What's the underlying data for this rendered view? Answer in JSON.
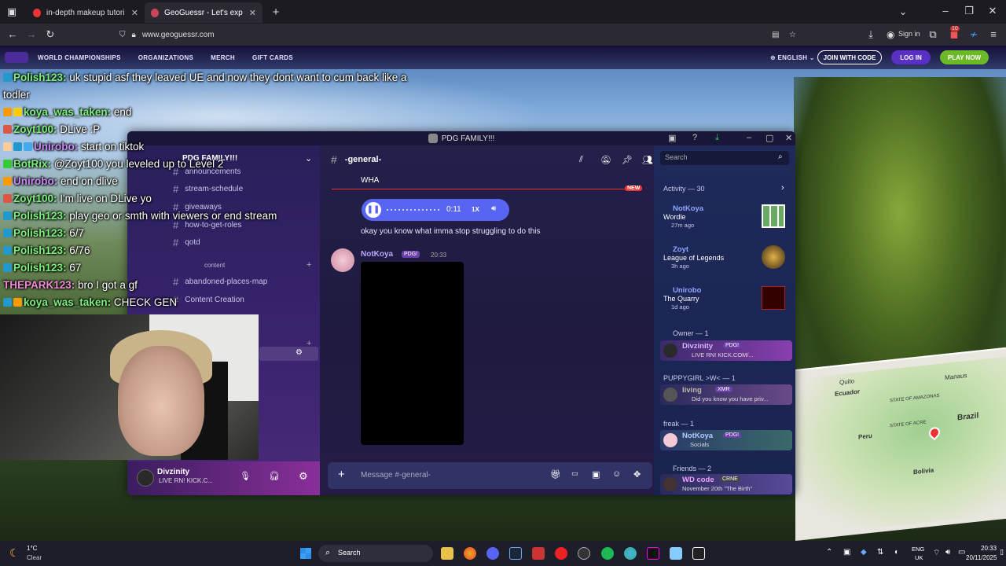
{
  "browser": {
    "tabs": [
      {
        "label": "in-depth makeup tutorial ��",
        "close": "✕"
      },
      {
        "label": "GeoGuessr - Let's explore the w",
        "close": "✕"
      }
    ],
    "new_tab": "+",
    "url": "www.geoguessr.com",
    "sign_in": "Sign in",
    "badge": "10"
  },
  "geoguessr": {
    "nav": [
      "WORLD CHAMPIONSHIPS",
      "ORGANIZATIONS",
      "MERCH",
      "GIFT CARDS"
    ],
    "language": "ENGLISH",
    "join": "JOIN WITH CODE",
    "login": "LOG IN",
    "play": "PLAY NOW"
  },
  "chat": [
    {
      "user": "Polish123:",
      "text": " uk stupid asf they leaved UE and now they dont want to cum back like a todler"
    },
    {
      "user": "koya_was_taken:",
      "text": " end"
    },
    {
      "user": "Zoyt100:",
      "text": " DLive :P"
    },
    {
      "user": "Unirobo:",
      "text": " start on tiktok"
    },
    {
      "user": "BotRix:",
      "text": " @Zoyt100 you leveled up to Level 2"
    },
    {
      "user": "Unirobo:",
      "text": " end on dlive"
    },
    {
      "user": "Zoyt100:",
      "text": " I'm live on DLive yo"
    },
    {
      "user": "Polish123:",
      "text": " play geo or smth with viewers or end stream"
    },
    {
      "user": "Polish123:",
      "text": " 6/7"
    },
    {
      "user": "Polish123:",
      "text": " 6/76"
    },
    {
      "user": "Polish123:",
      "text": " 67"
    },
    {
      "user": "THEPARK123:",
      "text": " bro I got a gf"
    },
    {
      "user": "koya_was_taken:",
      "text": " CHECK GEN"
    }
  ],
  "discord": {
    "window_title": "PDG FAMILY!!!",
    "server_name": "PDG FAMILY!!!",
    "channels": [
      {
        "name": "announcements"
      },
      {
        "name": "stream-schedule"
      },
      {
        "name": "giveaways"
      },
      {
        "name": "how-to-get-roles"
      },
      {
        "name": "qotd"
      },
      {
        "name": "content"
      },
      {
        "name": "abandoned-places-map"
      },
      {
        "name": "Content Creation"
      }
    ],
    "user": {
      "name": "Divzinity",
      "status": "LIVE RN! KICK.C..."
    },
    "channel_header": "-general-",
    "search_placeholder": "Search",
    "messages": {
      "wha": "WHA",
      "new": "NEW",
      "voice_time": "0:11",
      "voice_speed": "1X",
      "text1": "okay you know what imma stop struggling to do this",
      "author": "NotKoya",
      "author_tag": "PDG!",
      "time": "20:33"
    },
    "composer_placeholder": "Message #-general-",
    "activity": {
      "header": "Activity — 30",
      "items": [
        {
          "user": "NotKoya",
          "game": "Wordle",
          "time": "27m ago"
        },
        {
          "user": "Zoyt",
          "game": "League of Legends",
          "time": "3h ago"
        },
        {
          "user": "Unirobo",
          "game": "The Quarry",
          "time": "1d ago"
        }
      ]
    },
    "sections": [
      {
        "label": "Owner — 1",
        "name": "Divzinity",
        "tag": "PDG!",
        "sub": "LIVE RN! KICK.COM/..."
      },
      {
        "label": "PUPPYGIRL >W< — 1",
        "name": "living",
        "tag": "XMR",
        "sub": "Did you know you have priv..."
      },
      {
        "label": "freak — 1",
        "name": "NotKoya",
        "tag": "PDG!",
        "sub": "Socials"
      },
      {
        "label": "Friends — 2",
        "name": "WD code",
        "tag": "CRNE",
        "sub": "November 20th \"The Birth\""
      }
    ]
  },
  "map": {
    "labels": [
      "Quito",
      "Ecuador",
      "Manaus",
      "Peru",
      "Brazil",
      "Bolivia",
      "STATE OF AMAZONAS",
      "STATE OF ACRE"
    ]
  },
  "taskbar": {
    "weather_temp": "1°C",
    "weather_text": "Clear",
    "search": "Search",
    "lang1": "ENG",
    "lang2": "UK",
    "time": "20:33",
    "date": "20/11/2025"
  },
  "colors": {
    "discord_accent": "#5865f2",
    "geo_green": "#6cb928",
    "chat_green": "#7cf37c"
  }
}
